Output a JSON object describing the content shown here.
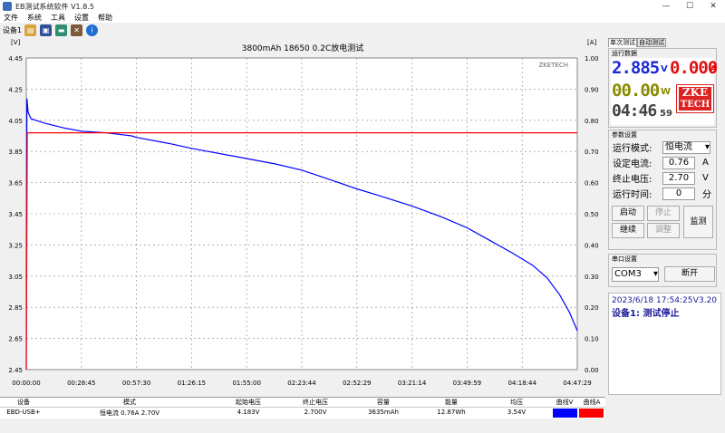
{
  "window": {
    "title": "EB测试系统软件 V1.8.5",
    "controls": [
      "—",
      "☐",
      "✕"
    ]
  },
  "menu": [
    "文件",
    "系统",
    "工具",
    "设置",
    "帮助"
  ],
  "toolbar": {
    "device": "设备1",
    "icons": [
      "open-icon",
      "save-icon",
      "export-icon",
      "tools-icon",
      "info-icon"
    ]
  },
  "chart_data": {
    "type": "line",
    "title": "3800mAh 18650 0.2C放电测试",
    "watermark": "ZKETECH",
    "ylabel_left": "[V]",
    "ylabel_right": "[A]",
    "ylim": [
      2.45,
      4.45
    ],
    "ylim_right": [
      0.0,
      1.0
    ],
    "yticks": [
      "4.45",
      "4.25",
      "4.05",
      "3.85",
      "3.65",
      "3.45",
      "3.25",
      "3.05",
      "2.85",
      "2.65",
      "2.45"
    ],
    "yticks_right": [
      "1.00",
      "0.90",
      "0.80",
      "0.70",
      "0.60",
      "0.50",
      "0.40",
      "0.30",
      "0.20",
      "0.10",
      "0.00"
    ],
    "xticks": [
      "00:00:00",
      "00:28:45",
      "00:57:30",
      "01:26:15",
      "01:55:00",
      "02:23:44",
      "02:52:29",
      "03:21:14",
      "03:49:59",
      "04:18:44",
      "04:47:29"
    ],
    "xlim_seconds": [
      0,
      17249
    ],
    "grid": true,
    "series": [
      {
        "name": "曲线V",
        "color": "#0000ff",
        "axis": "left",
        "points": [
          [
            0,
            2.45
          ],
          [
            20,
            4.19
          ],
          [
            60,
            4.1
          ],
          [
            150,
            4.06
          ],
          [
            300,
            4.05
          ],
          [
            600,
            4.03
          ],
          [
            1200,
            4.0
          ],
          [
            1725,
            3.98
          ],
          [
            2500,
            3.97
          ],
          [
            3300,
            3.95
          ],
          [
            3450,
            3.94
          ],
          [
            4500,
            3.9
          ],
          [
            5175,
            3.87
          ],
          [
            6500,
            3.82
          ],
          [
            7800,
            3.77
          ],
          [
            8625,
            3.73
          ],
          [
            9500,
            3.67
          ],
          [
            10350,
            3.61
          ],
          [
            11000,
            3.57
          ],
          [
            12075,
            3.5
          ],
          [
            13000,
            3.43
          ],
          [
            13800,
            3.36
          ],
          [
            14500,
            3.28
          ],
          [
            15200,
            3.2
          ],
          [
            15850,
            3.12
          ],
          [
            16300,
            3.04
          ],
          [
            16700,
            2.93
          ],
          [
            17000,
            2.82
          ],
          [
            17249,
            2.7
          ]
        ]
      },
      {
        "name": "曲线A",
        "color": "#ff0000",
        "axis": "right",
        "points": [
          [
            0,
            0.0
          ],
          [
            30,
            0.76
          ],
          [
            17249,
            0.76
          ]
        ]
      }
    ]
  },
  "tabs": {
    "single": "单次测试",
    "auto": "自动测试"
  },
  "runtime": {
    "title": "运行数据",
    "voltage": "2.885",
    "voltage_unit": "V",
    "current": "0.000",
    "current_unit": "A",
    "power": "00.00",
    "power_unit": "W",
    "time": "04:46",
    "time_sec": "59",
    "logo_line1": "ZKE",
    "logo_line2": "TECH"
  },
  "params": {
    "title": "参数设置",
    "mode_label": "运行模式:",
    "mode_value": "恒电流",
    "current_label": "设定电流:",
    "current_value": "0.76",
    "current_unit": "A",
    "cutoff_label": "终止电压:",
    "cutoff_value": "2.70",
    "cutoff_unit": "V",
    "time_label": "运行时间:",
    "time_value": "0",
    "time_unit": "分",
    "start": "启动",
    "stop": "停止",
    "resume": "继续",
    "adjust": "调整",
    "monitor": "监测"
  },
  "serial": {
    "title": "串口设置",
    "port": "COM3",
    "disconnect": "断开"
  },
  "status": {
    "datetime": "2023/6/18 17:54:25",
    "version": "V3.20",
    "message": "设备1: 测试停止"
  },
  "table": {
    "headers": [
      "设备",
      "模式",
      "起始电压",
      "终止电压",
      "容量",
      "能量",
      "均压",
      "曲线V",
      "曲线A"
    ],
    "row": [
      "EBD-USB+",
      "恒电流  0.76A  2.70V",
      "4.183V",
      "2.700V",
      "3635mAh",
      "12.87Wh",
      "3.54V",
      "",
      ""
    ],
    "colors": {
      "curveV": "#0000ff",
      "curveA": "#ff0000"
    }
  }
}
